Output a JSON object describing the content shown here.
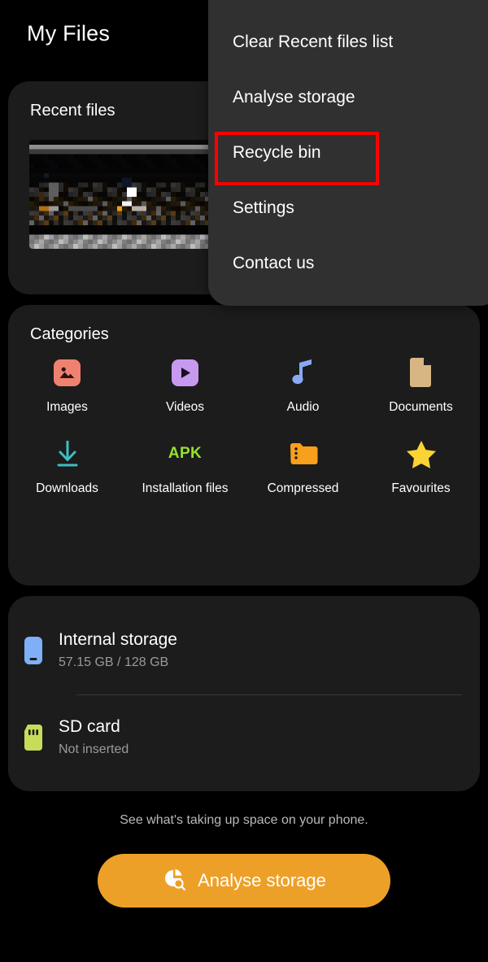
{
  "app": {
    "title": "My Files"
  },
  "recent": {
    "title": "Recent files",
    "thumbnail_name": "blurred-recent-file-thumbnail"
  },
  "categories": {
    "title": "Categories",
    "items": [
      {
        "label": "Images",
        "icon": "image-icon",
        "color": "#ef8170"
      },
      {
        "label": "Videos",
        "icon": "video-play-icon",
        "color": "#c79af0"
      },
      {
        "label": "Audio",
        "icon": "music-note-icon",
        "color": "#8aa9f5"
      },
      {
        "label": "Documents",
        "icon": "document-icon",
        "color": "#d8b683"
      },
      {
        "label": "Downloads",
        "icon": "download-icon",
        "color": "#3dbfc4"
      },
      {
        "label": "Installation files",
        "icon": "apk-icon",
        "color": "#97e02e"
      },
      {
        "label": "Compressed",
        "icon": "zip-folder-icon",
        "color": "#f8a01c"
      },
      {
        "label": "Favourites",
        "icon": "star-icon",
        "color": "#fbd335"
      }
    ]
  },
  "storage": {
    "internal": {
      "name": "Internal storage",
      "usage": "57.15 GB / 128 GB",
      "icon": "phone-icon",
      "color": "#7fb0f7"
    },
    "sd": {
      "name": "SD card",
      "status": "Not inserted",
      "icon": "sd-card-icon",
      "color": "#c8dc5a"
    }
  },
  "footer": {
    "note": "See what's taking up space on your phone.",
    "analyse_label": "Analyse storage",
    "analyse_icon": "pie-chart-search-icon",
    "accent_color": "#eda028"
  },
  "menu": {
    "items": [
      {
        "label": "Clear Recent files list",
        "highlighted": false
      },
      {
        "label": "Analyse storage",
        "highlighted": false
      },
      {
        "label": "Recycle bin",
        "highlighted": true
      },
      {
        "label": "Settings",
        "highlighted": false
      },
      {
        "label": "Contact us",
        "highlighted": false
      }
    ],
    "highlight_color": "#ff0000"
  }
}
